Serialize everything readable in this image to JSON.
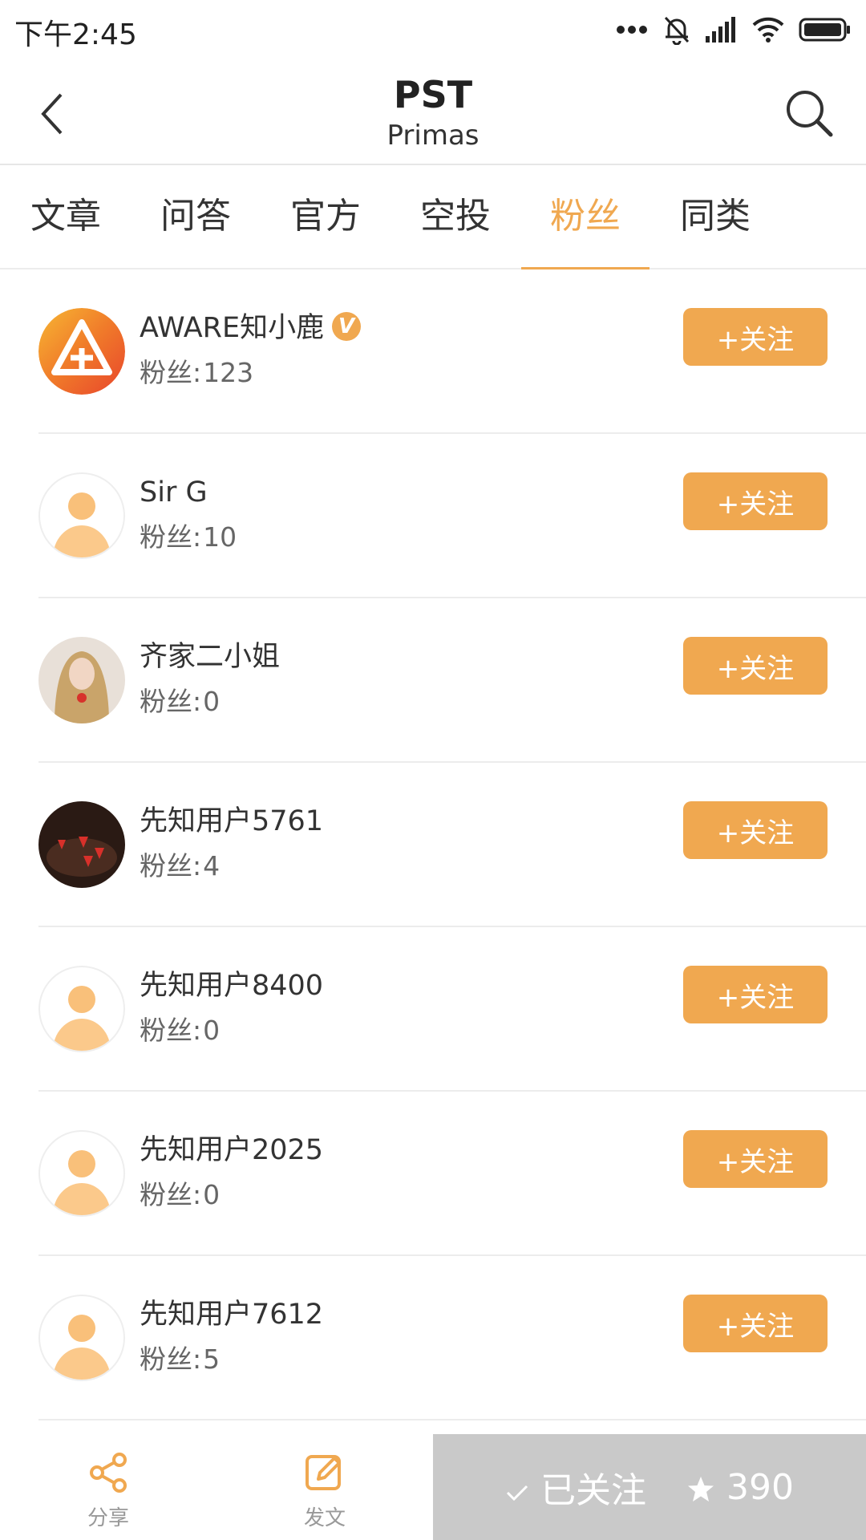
{
  "status_bar": {
    "time": "下午2:45",
    "icons": [
      "more-dots-icon",
      "bell-muted-icon",
      "signal-icon",
      "wifi-icon",
      "battery-icon"
    ]
  },
  "header": {
    "title": "PST",
    "subtitle": "Primas",
    "back_icon": "back-chevron-icon",
    "search_icon": "search-icon"
  },
  "tabs": [
    {
      "label": "文章",
      "active": false
    },
    {
      "label": "问答",
      "active": false
    },
    {
      "label": "官方",
      "active": false
    },
    {
      "label": "空投",
      "active": false
    },
    {
      "label": "粉丝",
      "active": true
    },
    {
      "label": "同类",
      "active": false
    }
  ],
  "fans_label": "粉丝:",
  "follow_label": "+关注",
  "verified_badge": "V",
  "users": [
    {
      "name": "AWARE知小鹿",
      "fans": "123",
      "verified": true,
      "avatar": "aware-logo"
    },
    {
      "name": "Sir G",
      "fans": "10",
      "verified": false,
      "avatar": "placeholder"
    },
    {
      "name": "齐家二小姐",
      "fans": "0",
      "verified": false,
      "avatar": "portrait-photo"
    },
    {
      "name": "先知用户5761",
      "fans": "4",
      "verified": false,
      "avatar": "strawberry-photo"
    },
    {
      "name": "先知用户8400",
      "fans": "0",
      "verified": false,
      "avatar": "placeholder"
    },
    {
      "name": "先知用户2025",
      "fans": "0",
      "verified": false,
      "avatar": "placeholder"
    },
    {
      "name": "先知用户7612",
      "fans": "5",
      "verified": false,
      "avatar": "placeholder"
    }
  ],
  "bottom_bar": {
    "share_label": "分享",
    "post_label": "发文",
    "followed_label": "已关注",
    "star_count": "390"
  },
  "colors": {
    "accent": "#f0a850",
    "followed_bg": "#c9c9c9",
    "text_primary": "#333333",
    "text_secondary": "#666666"
  }
}
